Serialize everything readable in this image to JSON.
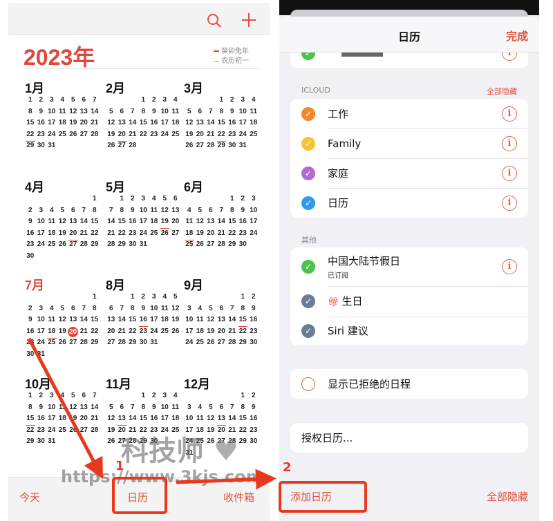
{
  "left": {
    "toolbar": {
      "search_icon": "search-icon",
      "add_icon": "plus-icon"
    },
    "year_title": "2023年",
    "legend": {
      "line1": "癸卯兔年",
      "line2": "农历初一"
    },
    "months": [
      {
        "name": "1月",
        "month": 1
      },
      {
        "name": "2月",
        "month": 2
      },
      {
        "name": "3月",
        "month": 3
      },
      {
        "name": "4月",
        "month": 4
      },
      {
        "name": "5月",
        "month": 5
      },
      {
        "name": "6月",
        "month": 6
      },
      {
        "name": "7月",
        "month": 7,
        "current": true
      },
      {
        "name": "8月",
        "month": 8
      },
      {
        "name": "9月",
        "month": 9
      },
      {
        "name": "10月",
        "month": 10
      },
      {
        "name": "11月",
        "month": 11
      },
      {
        "name": "12月",
        "month": 12
      }
    ],
    "year": 2023,
    "today": {
      "month": 7,
      "day": 20
    },
    "lunar_month_starts": {
      "1": 22,
      "2": 20,
      "3": 22,
      "4": 20,
      "5": 19,
      "6": 18,
      "7": 18,
      "8": 16,
      "9": 15,
      "10": 15,
      "11": 13,
      "12": 13
    },
    "bottom_tabs": {
      "today": "今天",
      "calendars": "日历",
      "inbox": "收件箱"
    }
  },
  "right": {
    "title": "日历",
    "done": "完成",
    "icloud_header": "ICLOUD",
    "hide_all_header": "全部隐藏",
    "icloud_items": [
      {
        "label": "工作",
        "color": "#f0892a"
      },
      {
        "label": "Family",
        "color": "#f7c235"
      },
      {
        "label": "家庭",
        "color": "#b36ad6"
      },
      {
        "label": "日历",
        "color": "#2e9bf0"
      }
    ],
    "other_header": "其他",
    "other_items": [
      {
        "label": "中国大陆节假日",
        "sub": "已订阅",
        "color": "#4cc34a"
      },
      {
        "label": "生日",
        "color": "#6b7c96"
      },
      {
        "label": "Siri 建议",
        "color": "#6b7c96"
      }
    ],
    "show_declined": "显示已拒绝的日程",
    "delegate": "授权日历...",
    "add_calendar": "添加日历",
    "hide_all": "全部隐藏"
  },
  "annotations": {
    "step1": "1",
    "step2": "2",
    "accent": "#e8381e"
  },
  "watermark": {
    "text": "科技师",
    "url": "https://www.3kjs.com"
  }
}
